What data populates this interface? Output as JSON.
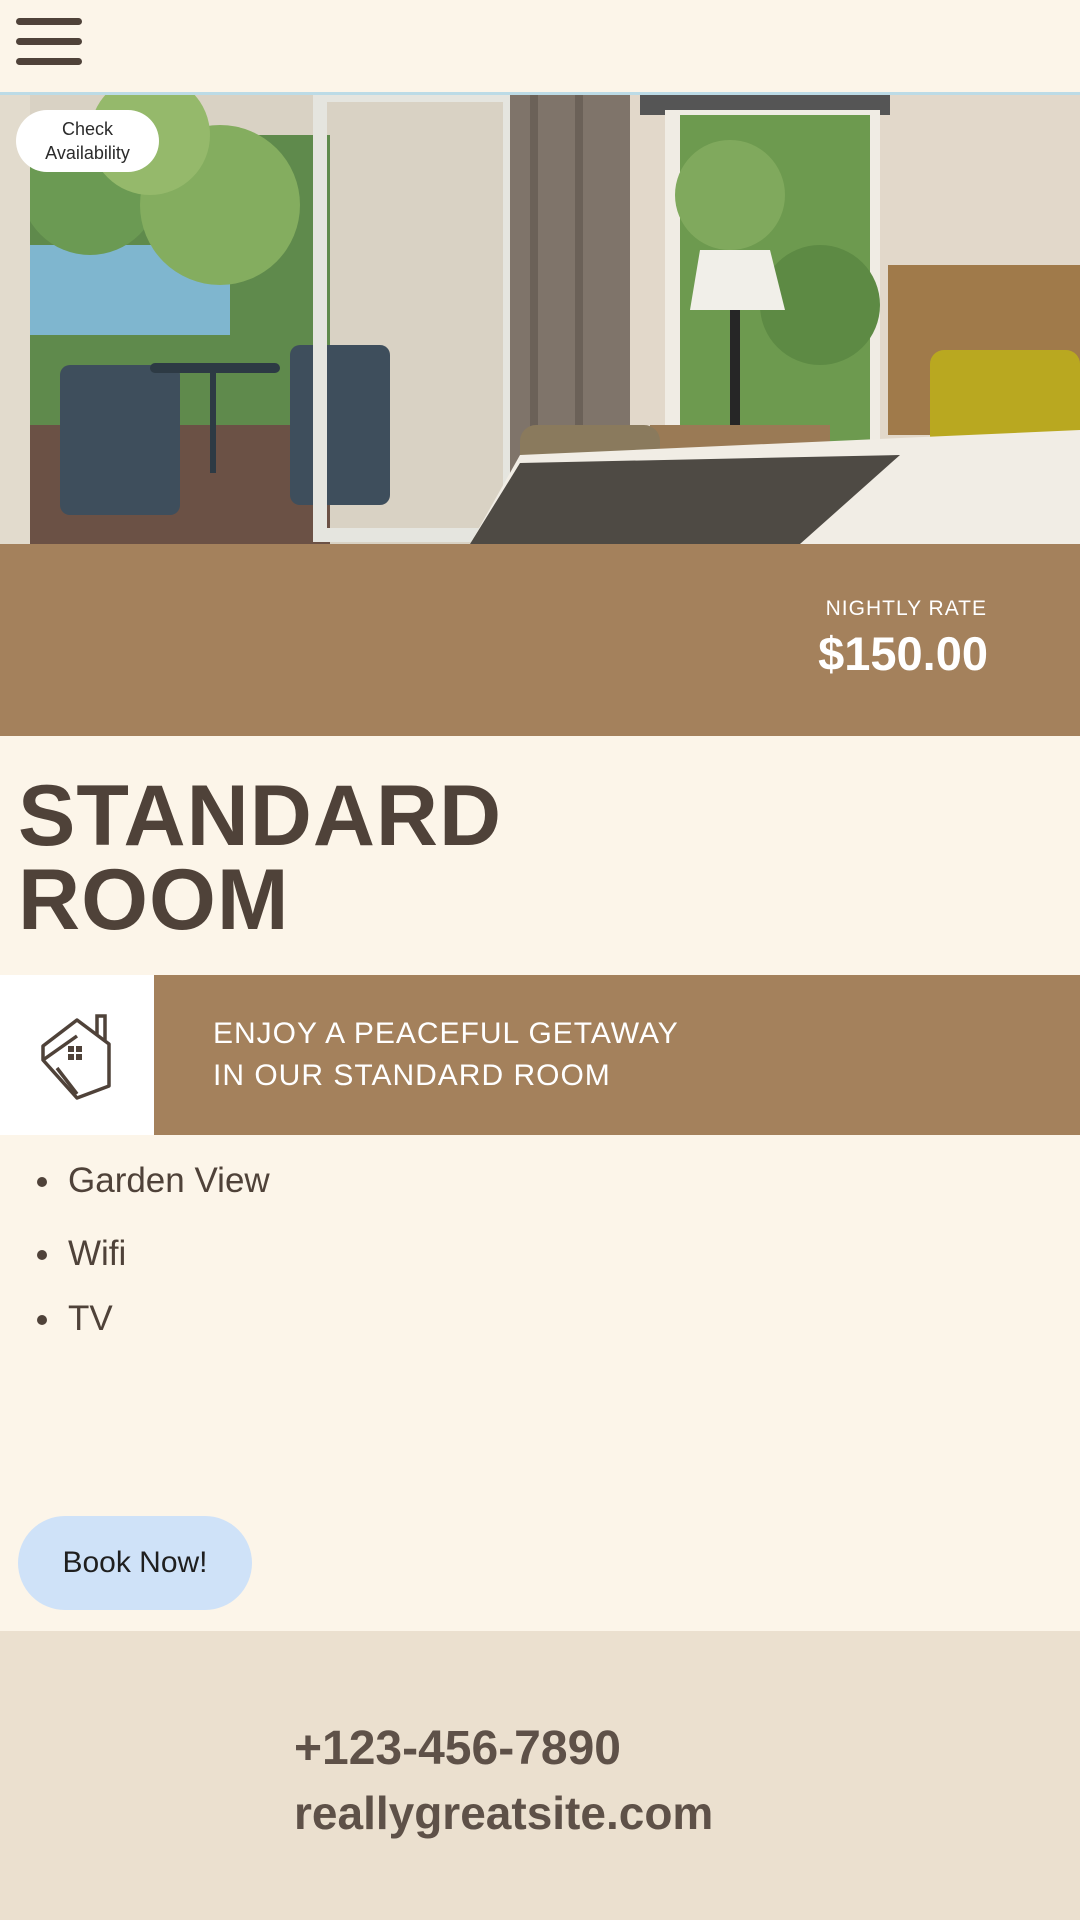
{
  "header": {
    "menu_icon": "hamburger-menu-icon"
  },
  "hero": {
    "check_availability_label": "Check Availability"
  },
  "rate": {
    "label": "NIGHTLY RATE",
    "value": "$150.00"
  },
  "room": {
    "title_line1": "STANDARD",
    "title_line2": "ROOM"
  },
  "tagline": {
    "icon": "house-icon",
    "line1": "ENJOY A PEACEFUL GETAWAY",
    "line2": "IN OUR STANDARD ROOM"
  },
  "amenities": [
    "Garden View",
    "Wifi",
    "TV"
  ],
  "cta": {
    "book_label": "Book Now!"
  },
  "footer": {
    "phone": "+123-456-7890",
    "website": "reallygreatsite.com"
  },
  "colors": {
    "page_bg": "#fcf5e9",
    "accent_brown": "#a4815c",
    "text_dark": "#4f4239",
    "button_blue": "#cfe2f8",
    "footer_bg": "#ebe0cf"
  }
}
